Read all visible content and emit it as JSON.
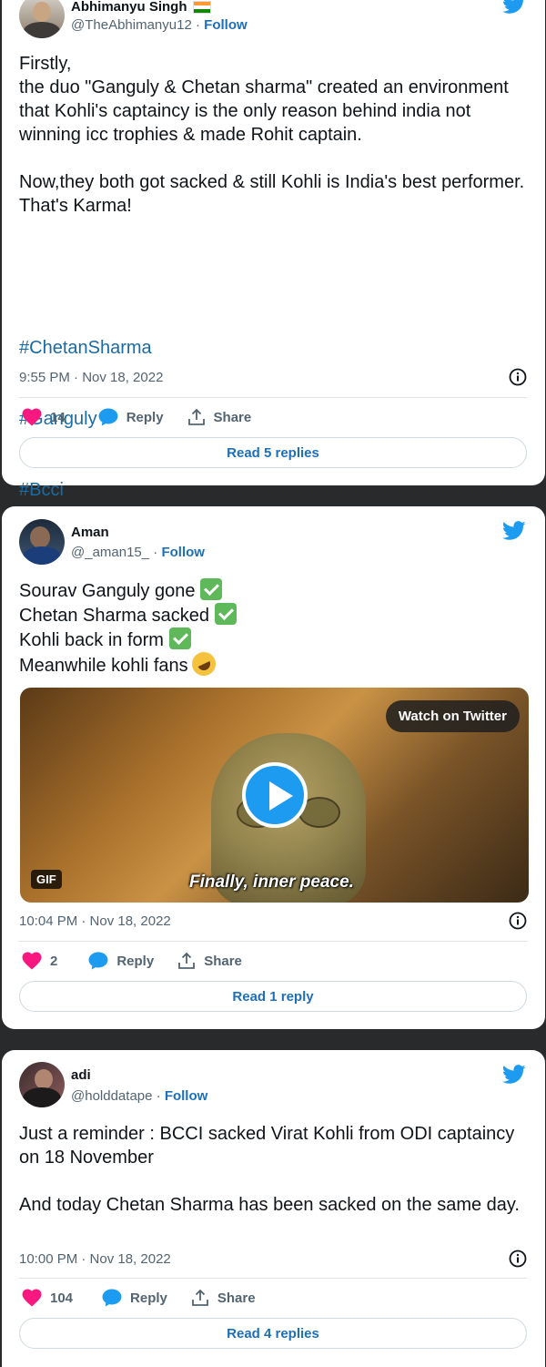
{
  "tweets": [
    {
      "name": "Abhimanyu Singh",
      "handle": "@TheAbhimanyu12",
      "follow": "Follow",
      "text": "Firstly,\nthe duo \"Ganguly & Chetan sharma\" created an environment that Kohli's captaincy is the only reason behind india not winning icc trophies & made Rohit captain.\n\nNow,they both got sacked & still Kohli is India's best performer.\nThat's Karma!",
      "hashtags": [
        "#ChetanSharma",
        "#Ganguly",
        "#Bcci"
      ],
      "timestamp": "9:55 PM · Nov 18, 2022",
      "likes": "14",
      "reply_label": "Reply",
      "share_label": "Share",
      "read_replies": "Read 5 replies"
    },
    {
      "name": "Aman",
      "handle": "@_aman15_",
      "follow": "Follow",
      "lines": [
        "Sourav Ganguly gone",
        "Chetan Sharma sacked",
        "Kohli back in form",
        "Meanwhile kohli fans"
      ],
      "media": {
        "watch_label": "Watch on Twitter",
        "gif_badge": "GIF",
        "caption": "Finally, inner peace."
      },
      "timestamp": "10:04 PM · Nov 18, 2022",
      "likes": "2",
      "reply_label": "Reply",
      "share_label": "Share",
      "read_replies": "Read 1 reply"
    },
    {
      "name": "adi",
      "handle": "@holddatape",
      "follow": "Follow",
      "text": "Just a reminder : BCCI sacked Virat Kohli from ODI captaincy on 18 November\n\nAnd today Chetan Sharma has been sacked on the same day.",
      "timestamp": "10:00 PM · Nov 18, 2022",
      "likes": "104",
      "reply_label": "Reply",
      "share_label": "Share",
      "read_replies": "Read 4 replies"
    }
  ],
  "colors": {
    "like": "#f91880",
    "reply": "#1d9bf0",
    "link": "#1d70b8",
    "twitter_bird": "#1d9bf0"
  }
}
